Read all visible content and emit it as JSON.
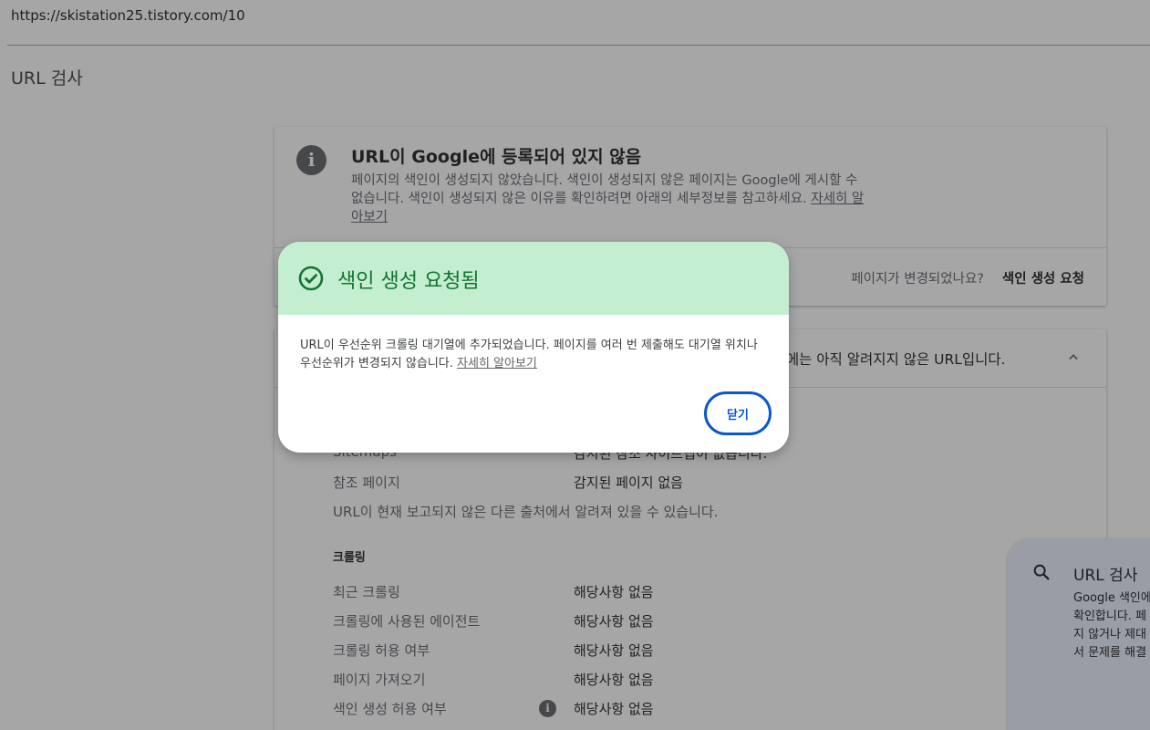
{
  "browser": {
    "url": "https://skistation25.tistory.com/10"
  },
  "page": {
    "title": "URL 검사"
  },
  "status_card": {
    "title": "URL이 Google에 등록되어 있지 않음",
    "desc_text": "페이지의 색인이 생성되지 않았습니다. 색인이 생성되지 않은 페이지는 Google에 게시할 수 없습니다. 색인이 생성되지 않은 이유를 확인하려면 아래의 세부정보를 참고하세요.",
    "learn_more": "자세히 알아보기",
    "changed_question": "페이지가 변경되었나요?",
    "request_indexing": "색인 생성 요청"
  },
  "detail_card": {
    "header": "le에는 아직 알려지지 않은 URL입니다.",
    "rows_discovery": [
      {
        "key": "Sitemaps",
        "value": "감지된 참조 사이트맵이 없습니다."
      },
      {
        "key": "참조 페이지",
        "value": "감지된 페이지 없음"
      }
    ],
    "note": "URL이 현재 보고되지 않은 다른 출처에서 알려져 있을 수 있습니다.",
    "crawl_section": "크롤링",
    "rows_crawl": [
      {
        "key": "최근 크롤링",
        "value": "해당사항 없음"
      },
      {
        "key": "크롤링에 사용된 에이전트",
        "value": "해당사항 없음"
      },
      {
        "key": "크롤링 허용 여부",
        "value": "해당사항 없음"
      },
      {
        "key": "페이지 가져오기",
        "value": "해당사항 없음"
      },
      {
        "key": "색인 생성 허용 여부",
        "value": "해당사항 없음"
      }
    ]
  },
  "side_panel": {
    "title": "URL 검사",
    "lines": [
      "Google 색인에",
      "확인합니다. 페",
      "지 않거나 제대",
      "서 문제를 해결"
    ]
  },
  "dialog": {
    "title": "색인 생성 요청됨",
    "body": "URL이 우선순위 크롤링 대기열에 추가되었습니다. 페이지를 여러 번 제출해도 대기열 위치나 우선순위가 변경되지 않습니다.",
    "learn_more": "자세히 알아보기",
    "close": "닫기"
  },
  "colors": {
    "dialog_header_bg": "#c4eed0",
    "success_green": "#137333",
    "primary_blue": "#0b57d0",
    "side_panel_bg": "#e8f0fe"
  },
  "icons": [
    "info-icon",
    "chevron-up-icon",
    "check-circle-icon",
    "search-icon"
  ]
}
